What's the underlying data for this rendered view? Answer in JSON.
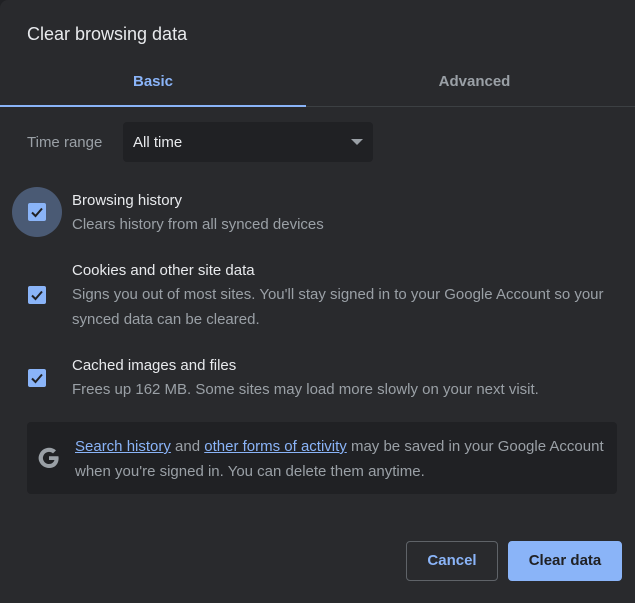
{
  "dialog": {
    "title": "Clear browsing data"
  },
  "tabs": [
    {
      "label": "Basic",
      "selected": true
    },
    {
      "label": "Advanced",
      "selected": false
    }
  ],
  "time_range": {
    "label": "Time range",
    "value": "All time"
  },
  "options": [
    {
      "title": "Browsing history",
      "description": "Clears history from all synced devices",
      "checked": true
    },
    {
      "title": "Cookies and other site data",
      "description": "Signs you out of most sites. You'll stay signed in to your Google Account so your synced data can be cleared.",
      "checked": true
    },
    {
      "title": "Cached images and files",
      "description": "Frees up 162 MB. Some sites may load more slowly on your next visit.",
      "checked": true
    }
  ],
  "info": {
    "icon": "google-g-icon",
    "link1": "Search history",
    "text1": " and ",
    "link2": "other forms of activity",
    "text2": " may be saved in your Google Account when you're signed in. You can delete them anytime."
  },
  "buttons": {
    "cancel": "Cancel",
    "clear": "Clear data"
  },
  "colors": {
    "accent": "#8ab4f8",
    "background": "#292a2d",
    "secondary_text": "#9aa0a6"
  }
}
